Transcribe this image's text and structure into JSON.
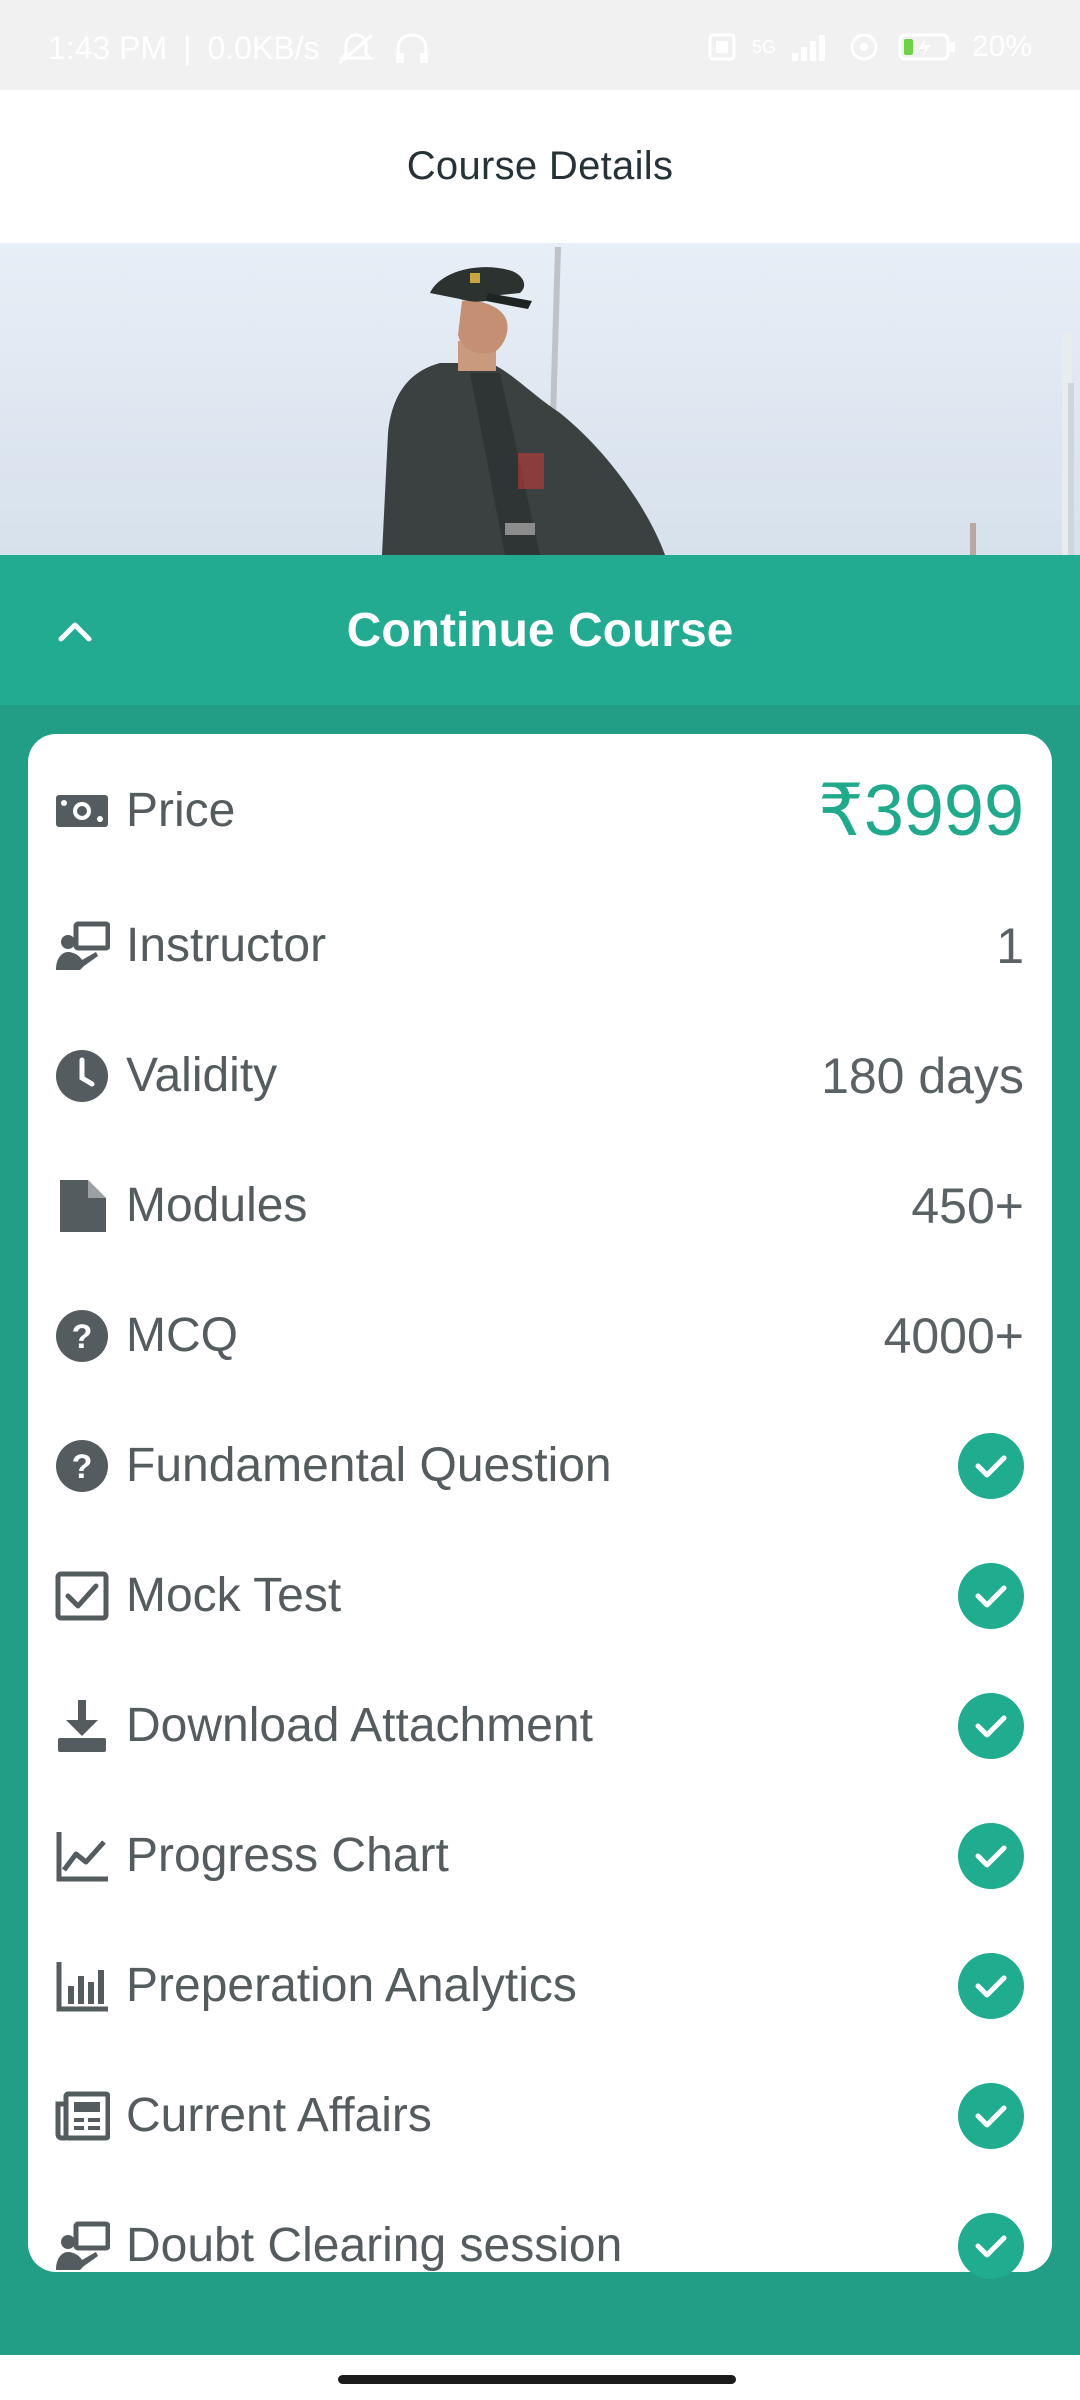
{
  "status_bar": {
    "time": "1:43 PM",
    "speed": "0.0KB/s",
    "network": "5G",
    "battery": "20%"
  },
  "app_bar": {
    "title": "Course Details"
  },
  "sheet": {
    "continue_label": "Continue Course"
  },
  "details": {
    "rows": [
      {
        "icon": "money-icon",
        "label": "Price",
        "value": "₹3999"
      },
      {
        "icon": "instructor-icon",
        "label": "Instructor",
        "value": "1"
      },
      {
        "icon": "clock-icon",
        "label": "Validity",
        "value": "180 days"
      },
      {
        "icon": "document-icon",
        "label": "Modules",
        "value": "450+"
      },
      {
        "icon": "question-icon",
        "label": "MCQ",
        "value": "4000+"
      },
      {
        "icon": "question-icon",
        "label": "Fundamental Question",
        "included": true
      },
      {
        "icon": "checkbox-icon",
        "label": "Mock Test",
        "included": true
      },
      {
        "icon": "download-icon",
        "label": "Download Attachment",
        "included": true
      },
      {
        "icon": "line-chart-icon",
        "label": "Progress Chart",
        "included": true
      },
      {
        "icon": "bar-chart-icon",
        "label": "Preperation Analytics",
        "included": true
      },
      {
        "icon": "newspaper-icon",
        "label": "Current Affairs",
        "included": true
      },
      {
        "icon": "instructor-icon",
        "label": "Doubt Clearing session",
        "included": true
      }
    ]
  },
  "colors": {
    "accent": "#22ab91",
    "sheet_bg": "#229e86",
    "price": "#21a98c",
    "text": "#555c5f",
    "title": "#263238"
  }
}
